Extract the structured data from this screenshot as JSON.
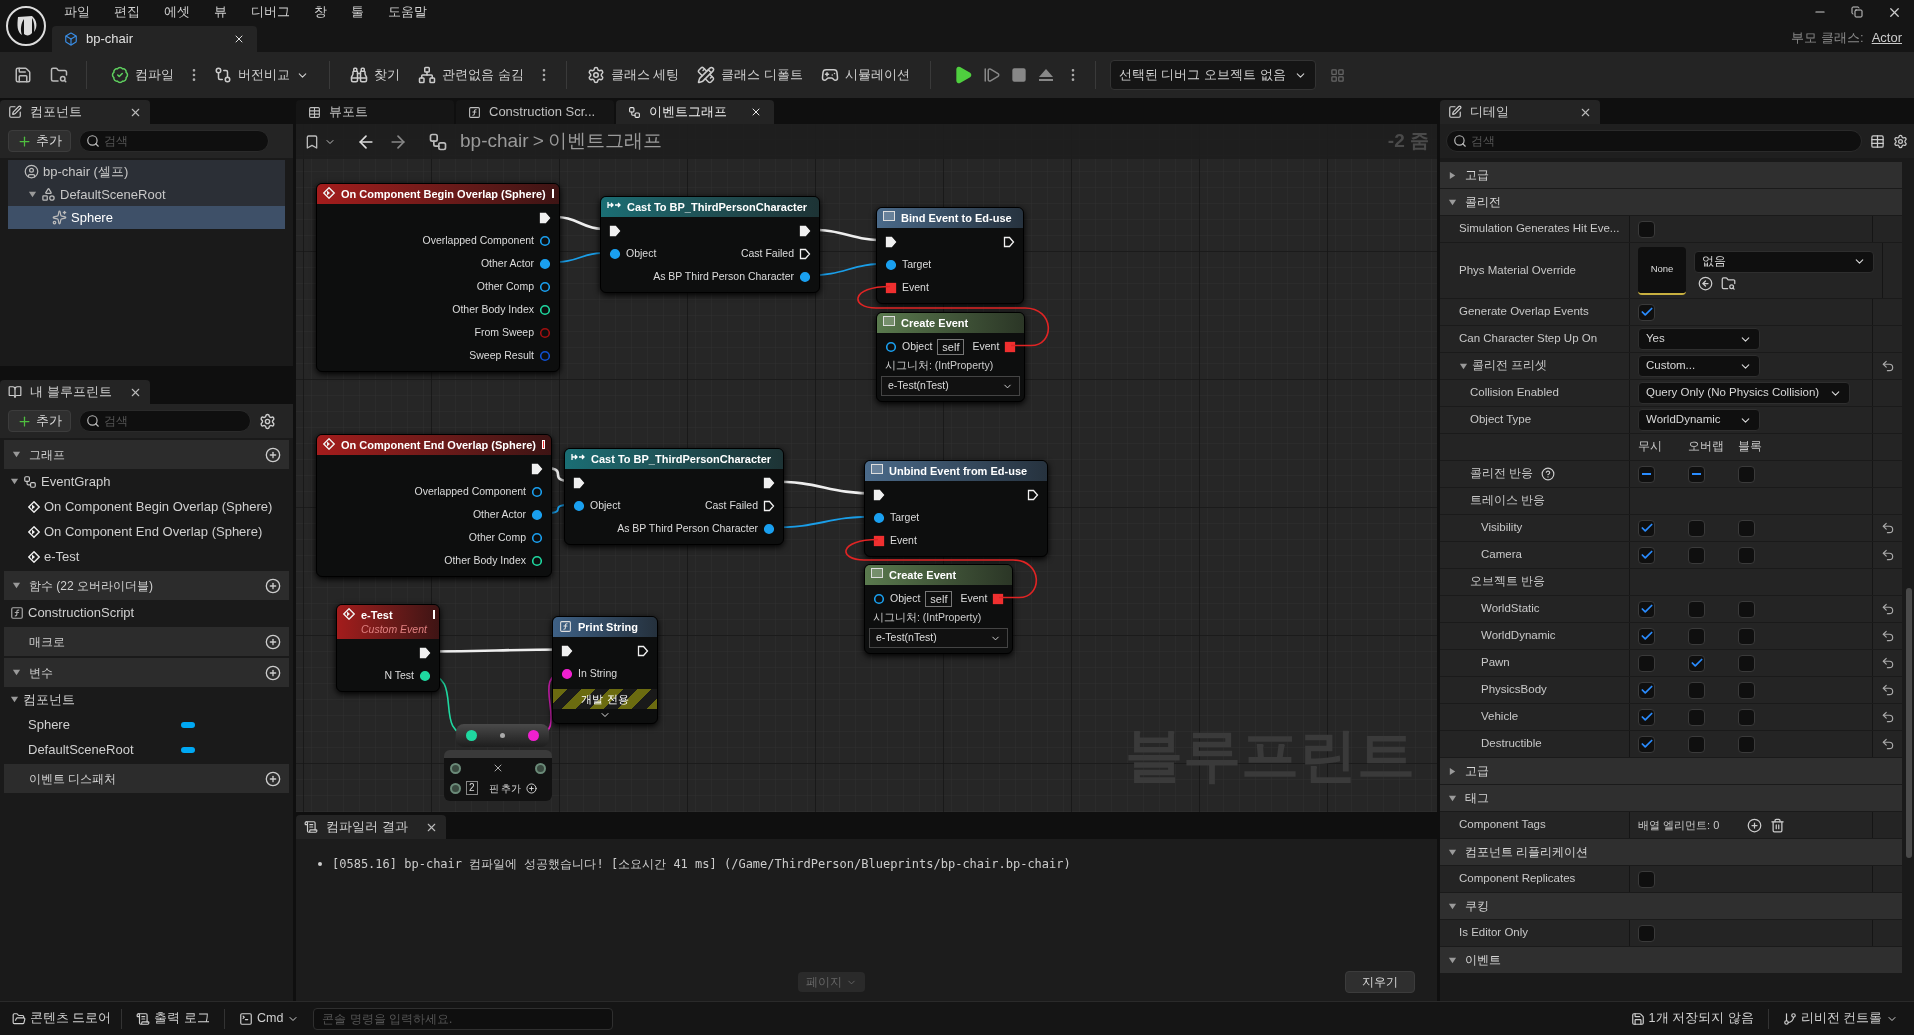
{
  "menu": [
    "파일",
    "편집",
    "에셋",
    "뷰",
    "디버그",
    "창",
    "툴",
    "도움말"
  ],
  "document_tab": {
    "label": "bp-chair"
  },
  "parent_class": {
    "label": "부모 클래스:",
    "value": "Actor"
  },
  "toolbar": [
    {
      "label": "컴파일",
      "kind": "options"
    },
    {
      "label": "버전비교",
      "kind": "dropdown"
    },
    {
      "label": "찾기",
      "kind": "plain"
    },
    {
      "label": "관련없음 숨김",
      "kind": "options"
    },
    {
      "label": "클래스 세팅",
      "kind": "plain"
    },
    {
      "label": "클래스 디폴트",
      "kind": "plain"
    },
    {
      "label": "시뮬레이션",
      "kind": "plain"
    }
  ],
  "debug_object": "선택된 디버그 오브젝트 없음",
  "components": {
    "title": "컴포넌트",
    "add": "추가",
    "search_placeholder": "검색",
    "tree": [
      {
        "label": "bp-chair (셀프)",
        "selected": false,
        "children": [
          {
            "label": "DefaultSceneRoot",
            "selected": false,
            "children": [
              {
                "label": "Sphere",
                "selected": true
              }
            ]
          }
        ]
      }
    ]
  },
  "my_blueprint": {
    "title": "내 블루프린트",
    "add": "추가",
    "search_placeholder": "검색",
    "sections": [
      {
        "title": "그래프",
        "items": [
          {
            "kind": "graph",
            "label": "EventGraph",
            "children": [
              {
                "kind": "event",
                "label": "On Component Begin Overlap (Sphere)"
              },
              {
                "kind": "event",
                "label": "On Component End Overlap (Sphere)"
              },
              {
                "kind": "event",
                "label": "e-Test"
              }
            ]
          }
        ]
      },
      {
        "title": "함수 (22 오버라이더블)",
        "items": [
          {
            "kind": "function",
            "label": "ConstructionScript"
          }
        ]
      },
      {
        "title": "매크로"
      },
      {
        "title": "변수",
        "items": [
          {
            "kind": "category",
            "label": "컴포넌트",
            "children": [
              {
                "kind": "variable",
                "label": "Sphere"
              },
              {
                "kind": "variable",
                "label": "DefaultSceneRoot"
              }
            ]
          }
        ]
      },
      {
        "title": "이벤트 디스패처"
      }
    ]
  },
  "graph_tabs": [
    {
      "label": "뷰포트",
      "kind": "viewport",
      "selected": false
    },
    {
      "label": "Construction Scr...",
      "kind": "function",
      "selected": false
    },
    {
      "label": "이벤트그래프",
      "kind": "graph",
      "selected": true
    }
  ],
  "breadcrumb": {
    "blueprint": "bp-chair",
    "separator": ">",
    "graph": "이벤트그래프"
  },
  "zoom_label": "-2 줌",
  "watermark": "블루프린트",
  "nodes": [
    {
      "kind": "event",
      "title": "On Component Begin Overlap (Sphere)",
      "rows": [
        {
          "right": {
            "kind": "exec",
            "connected": true
          }
        },
        {
          "right": {
            "label": "Overlapped Component",
            "kind": "object",
            "connected": false
          }
        },
        {
          "right": {
            "label": "Other Actor",
            "kind": "object",
            "connected": true
          }
        },
        {
          "right": {
            "label": "Other Comp",
            "kind": "object",
            "connected": false
          }
        },
        {
          "right": {
            "label": "Other Body Index",
            "kind": "int",
            "connected": false
          }
        },
        {
          "right": {
            "label": "From Sweep",
            "kind": "bool",
            "connected": false
          }
        },
        {
          "right": {
            "label": "Sweep Result",
            "kind": "struct",
            "connected": false
          }
        }
      ]
    },
    {
      "kind": "cast",
      "title": "Cast To BP_ThirdPersonCharacter",
      "rows": [
        {
          "left": {
            "kind": "exec",
            "connected": true
          },
          "right": {
            "kind": "exec",
            "connected": true
          }
        },
        {
          "left": {
            "label": "Object",
            "kind": "object",
            "connected": true
          },
          "right": {
            "label": "Cast Failed",
            "kind": "exec",
            "connected": false
          }
        },
        {
          "right": {
            "label": "As BP Third Person Character",
            "kind": "object",
            "connected": true
          }
        }
      ]
    },
    {
      "kind": "call",
      "title": "Bind Event to Ed-use",
      "rows": [
        {
          "left": {
            "kind": "exec",
            "connected": true
          },
          "right": {
            "kind": "exec",
            "connected": false
          }
        },
        {
          "left": {
            "label": "Target",
            "kind": "object",
            "connected": true
          }
        },
        {
          "left": {
            "label": "Event",
            "kind": "delegate",
            "connected": true
          }
        }
      ]
    },
    {
      "kind": "create_event",
      "title": "Create Event",
      "rows": [
        {
          "left": {
            "label": "Object",
            "kind": "object",
            "connected": false,
            "value": "self"
          },
          "right": {
            "label": "Event",
            "kind": "delegate",
            "connected": true
          }
        }
      ],
      "signature": "시그니처: (IntProperty)",
      "function": "e-Test(nTest)"
    },
    {
      "kind": "event",
      "title": "On Component End Overlap (Sphere)",
      "rows": [
        {
          "right": {
            "kind": "exec",
            "connected": true
          }
        },
        {
          "right": {
            "label": "Overlapped Component",
            "kind": "object",
            "connected": false
          }
        },
        {
          "right": {
            "label": "Other Actor",
            "kind": "object",
            "connected": true
          }
        },
        {
          "right": {
            "label": "Other Comp",
            "kind": "object",
            "connected": false
          }
        },
        {
          "right": {
            "label": "Other Body Index",
            "kind": "int",
            "connected": false
          }
        }
      ]
    },
    {
      "kind": "cast",
      "title": "Cast To BP_ThirdPersonCharacter",
      "rows": [
        {
          "left": {
            "kind": "exec",
            "connected": true
          },
          "right": {
            "kind": "exec",
            "connected": true
          }
        },
        {
          "left": {
            "label": "Object",
            "kind": "object",
            "connected": true
          },
          "right": {
            "label": "Cast Failed",
            "kind": "exec",
            "connected": false
          }
        },
        {
          "right": {
            "label": "As BP Third Person Character",
            "kind": "object",
            "connected": true
          }
        }
      ]
    },
    {
      "kind": "call",
      "title": "Unbind Event from Ed-use",
      "rows": [
        {
          "left": {
            "kind": "exec",
            "connected": true
          },
          "right": {
            "kind": "exec",
            "connected": false
          }
        },
        {
          "left": {
            "label": "Target",
            "kind": "object",
            "connected": true
          }
        },
        {
          "left": {
            "label": "Event",
            "kind": "delegate",
            "connected": true
          }
        }
      ]
    },
    {
      "kind": "create_event",
      "title": "Create Event",
      "rows": [
        {
          "left": {
            "label": "Object",
            "kind": "object",
            "connected": false,
            "value": "self"
          },
          "right": {
            "label": "Event",
            "kind": "delegate",
            "connected": true
          }
        }
      ],
      "signature": "시그니처: (IntProperty)",
      "function": "e-Test(nTest)"
    },
    {
      "kind": "custom_event",
      "title": "e-Test",
      "subtitle": "Custom Event",
      "rows": [
        {
          "right": {
            "kind": "exec",
            "connected": true
          }
        },
        {
          "right": {
            "label": "N Test",
            "kind": "int",
            "connected": true
          }
        }
      ]
    },
    {
      "kind": "function",
      "title": "Print String",
      "rows": [
        {
          "left": {
            "kind": "exec",
            "connected": true
          },
          "right": {
            "kind": "exec",
            "connected": false
          }
        },
        {
          "left": {
            "label": "In String",
            "kind": "string",
            "connected": true
          }
        }
      ],
      "note": "개발 전용"
    },
    {
      "kind": "conversion"
    },
    {
      "kind": "make_array",
      "index": "2",
      "add_pin": "핀 추가"
    }
  ],
  "compiler": {
    "title": "컴파일러 결과",
    "messages": [
      "[0585.16] bp-chair 컴파일에 성공했습니다! [소요시간 41 ms] (/Game/ThirdPerson/Blueprints/bp-chair.bp-chair)"
    ],
    "pages": "페이지",
    "clear": "지우기"
  },
  "details": {
    "title": "디테일",
    "search_placeholder": "검색",
    "rows": [
      {
        "kind": "category",
        "label": "고급",
        "expanded": false
      },
      {
        "kind": "category",
        "label": "콜리전",
        "expanded": true,
        "children": [
          {
            "kind": "checkbox",
            "label": "Simulation Generates Hit Eve...",
            "checked": false
          },
          {
            "kind": "material",
            "label": "Phys Material Override",
            "thumbnail": "None",
            "value": "없음"
          },
          {
            "kind": "checkbox",
            "label": "Generate Overlap Events",
            "checked": true
          },
          {
            "kind": "dropdown",
            "label": "Can Character Step Up On",
            "value": "Yes",
            "reset": false
          },
          {
            "kind": "group",
            "label": "콜리전 프리셋",
            "value": "Custom...",
            "expanded": true,
            "reset": true,
            "children": [
              {
                "kind": "dropdown",
                "label": "Collision Enabled",
                "value": "Query Only (No Physics Collision)",
                "reset": false
              },
              {
                "kind": "dropdown",
                "label": "Object Type",
                "value": "WorldDynamic",
                "reset": false
              },
              {
                "kind": "columns",
                "labels": [
                  "무시",
                  "오버랩",
                  "블록"
                ]
              },
              {
                "kind": "response_header",
                "label": "콜리전 반응",
                "reset": false,
                "cells": [
                  {
                    "mixed": true
                  },
                  {
                    "mixed": true
                  },
                  {
                    "mixed": false
                  }
                ]
              },
              {
                "kind": "heading",
                "label": "트레이스 반응",
                "children": [
                  {
                    "kind": "response",
                    "label": "Visibility",
                    "reset": true,
                    "cells": [
                      {
                        "checked": true
                      },
                      {
                        "checked": false
                      },
                      {
                        "checked": false
                      }
                    ]
                  },
                  {
                    "kind": "response",
                    "label": "Camera",
                    "reset": true,
                    "cells": [
                      {
                        "checked": true
                      },
                      {
                        "checked": false
                      },
                      {
                        "checked": false
                      }
                    ]
                  }
                ]
              },
              {
                "kind": "heading",
                "label": "오브젝트 반응",
                "children": [
                  {
                    "kind": "response",
                    "label": "WorldStatic",
                    "reset": true,
                    "cells": [
                      {
                        "checked": true
                      },
                      {
                        "checked": false
                      },
                      {
                        "checked": false
                      }
                    ]
                  },
                  {
                    "kind": "response",
                    "label": "WorldDynamic",
                    "reset": true,
                    "cells": [
                      {
                        "checked": true
                      },
                      {
                        "checked": false
                      },
                      {
                        "checked": false
                      }
                    ]
                  },
                  {
                    "kind": "response",
                    "label": "Pawn",
                    "reset": true,
                    "cells": [
                      {
                        "checked": false
                      },
                      {
                        "checked": true
                      },
                      {
                        "checked": false
                      }
                    ]
                  },
                  {
                    "kind": "response",
                    "label": "PhysicsBody",
                    "reset": true,
                    "cells": [
                      {
                        "checked": true
                      },
                      {
                        "checked": false
                      },
                      {
                        "checked": false
                      }
                    ]
                  },
                  {
                    "kind": "response",
                    "label": "Vehicle",
                    "reset": true,
                    "cells": [
                      {
                        "checked": true
                      },
                      {
                        "checked": false
                      },
                      {
                        "checked": false
                      }
                    ]
                  },
                  {
                    "kind": "response",
                    "label": "Destructible",
                    "reset": true,
                    "cells": [
                      {
                        "checked": true
                      },
                      {
                        "checked": false
                      },
                      {
                        "checked": false
                      }
                    ]
                  }
                ]
              }
            ]
          }
        ]
      },
      {
        "kind": "category",
        "label": "고급",
        "expanded": false
      },
      {
        "kind": "category",
        "label": "태그",
        "expanded": true,
        "children": [
          {
            "kind": "array",
            "label": "Component Tags",
            "value": "배열 엘리먼트: 0"
          }
        ]
      },
      {
        "kind": "category",
        "label": "컴포넌트 리플리케이션",
        "expanded": true,
        "children": [
          {
            "kind": "checkbox",
            "label": "Component Replicates",
            "checked": false
          }
        ]
      },
      {
        "kind": "category",
        "label": "쿠킹",
        "expanded": true,
        "children": [
          {
            "kind": "checkbox",
            "label": "Is Editor Only",
            "checked": false
          }
        ]
      },
      {
        "kind": "category",
        "label": "이벤트",
        "expanded": true
      }
    ]
  },
  "status_bar": {
    "content_drawer": "콘텐츠 드로어",
    "output_log": "출력 로그",
    "cmd": "Cmd",
    "console_placeholder": "콘솔 명령을 입력하세요.",
    "unsaved": "1개 저장되지 않음",
    "revision": "리비전 컨트롤"
  }
}
